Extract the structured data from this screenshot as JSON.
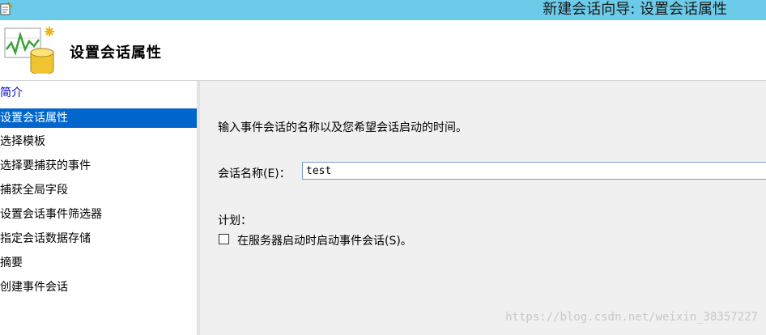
{
  "window": {
    "title": "新建会话向导: 设置会话属性"
  },
  "header": {
    "heading": "设置会话属性"
  },
  "sidebar": {
    "items": [
      {
        "label": "简介"
      },
      {
        "label": "设置会话属性"
      },
      {
        "label": "选择模板"
      },
      {
        "label": "选择要捕获的事件"
      },
      {
        "label": "捕获全局字段"
      },
      {
        "label": "设置会话事件筛选器"
      },
      {
        "label": "指定会话数据存储"
      },
      {
        "label": "摘要"
      },
      {
        "label": "创建事件会话"
      }
    ],
    "active_index": 1
  },
  "main": {
    "instructions": "输入事件会话的名称以及您希望会话启动的时间。",
    "name_label": "会话名称(E)：",
    "name_value": "test",
    "schedule_label": "计划：",
    "start_on_server_start": {
      "label": "在服务器启动时启动事件会话(S)。",
      "checked": false
    }
  },
  "watermark": "https://blog.csdn.net/weixin_38357227",
  "colors": {
    "titlebar": "#6ccbe9",
    "selection": "#0066cc",
    "link": "#0000cc"
  },
  "icons": {
    "app": "wizard-app-icon",
    "banner": "chart-database-icon"
  }
}
